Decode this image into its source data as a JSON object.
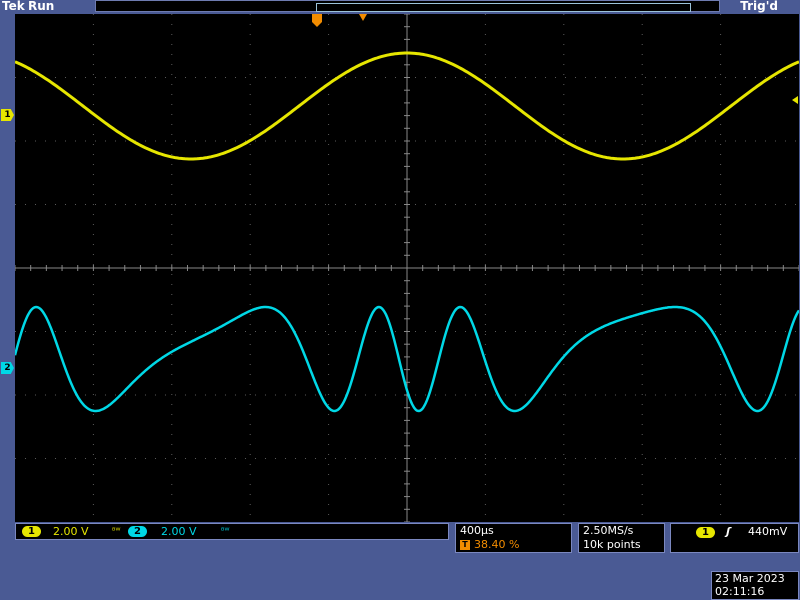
{
  "header": {
    "brand": "Tek",
    "acquisition_state": "Run",
    "trigger_state": "Trig'd"
  },
  "markers": {
    "ch1": "1",
    "ch2": "2",
    "trigger_position": "T"
  },
  "channels": [
    {
      "id": "1",
      "scale": "2.00 V",
      "bandwidth_icon": "bw-limit-icon",
      "color": "#e6e600"
    },
    {
      "id": "2",
      "scale": "2.00 V",
      "bandwidth_icon": "bw-limit-icon",
      "color": "#00d8e6"
    }
  ],
  "timebase": {
    "time_per_div": "400µs",
    "trigger_position_icon": "T",
    "trigger_position": "38.40 %"
  },
  "acquisition": {
    "sample_rate": "2.50MS/s",
    "record_length": "10k points"
  },
  "trigger": {
    "source": "1",
    "slope_icon": "rising-edge-icon",
    "level": "440mV"
  },
  "datetime": {
    "date": "23 Mar 2023",
    "time": "02:11:16"
  },
  "colors": {
    "ch1": "#e6e600",
    "ch2": "#00d8e6",
    "trigger": "#f28c00",
    "frame": "#4a5a94"
  }
}
